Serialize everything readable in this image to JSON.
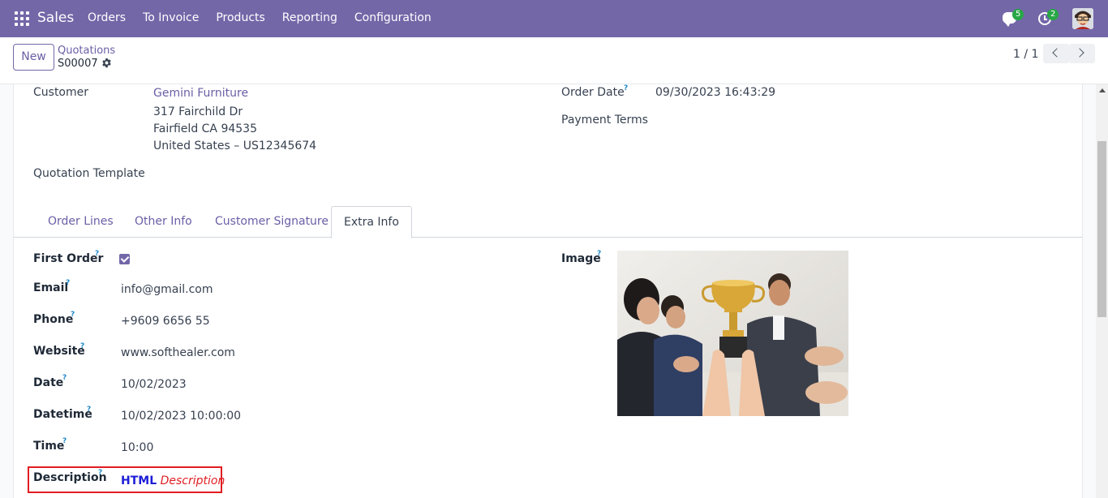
{
  "navbar": {
    "app_name": "Sales",
    "menu": [
      "Orders",
      "To Invoice",
      "Products",
      "Reporting",
      "Configuration"
    ],
    "messages_count": "5",
    "activities_count": "2",
    "color": "#7367a8"
  },
  "control": {
    "new_label": "New",
    "breadcrumb_parent": "Quotations",
    "breadcrumb_current": "S00007",
    "pager": "1 / 1"
  },
  "header_fields": {
    "customer_label": "Customer",
    "customer_name": "Gemini Furniture",
    "customer_address": [
      "317 Fairchild Dr",
      "Fairfield CA 94535",
      "United States – US12345674"
    ],
    "quotation_template_label": "Quotation Template",
    "order_date_label": "Order Date",
    "order_date_value": "09/30/2023 16:43:29",
    "payment_terms_label": "Payment Terms"
  },
  "tabs": [
    "Order Lines",
    "Other Info",
    "Customer Signature",
    "Extra Info"
  ],
  "active_tab": "Extra Info",
  "extra_info": {
    "first_order_label": "First Order",
    "first_order_checked": true,
    "email_label": "Email",
    "email_value": "info@gmail.com",
    "phone_label": "Phone",
    "phone_value": "+9609 6656 55",
    "website_label": "Website",
    "website_value": "www.softhealer.com",
    "date_label": "Date",
    "date_value": "10/02/2023",
    "datetime_label": "Datetime",
    "datetime_value": "10/02/2023 10:00:00",
    "time_label": "Time",
    "time_value": "10:00",
    "description_label": "Description",
    "description_html": "HTML",
    "description_text": "Description",
    "image_label": "Image"
  },
  "help_mark": "?"
}
